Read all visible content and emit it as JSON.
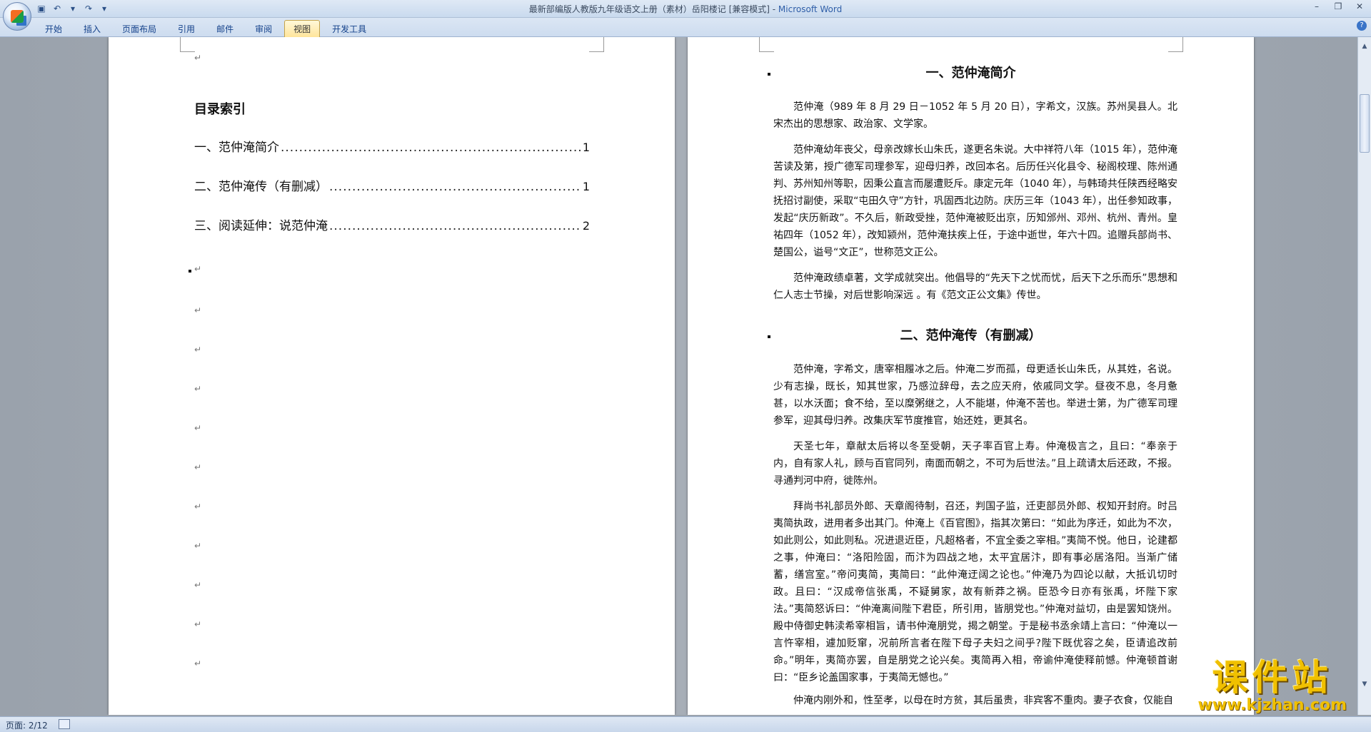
{
  "window": {
    "title": "最新部编版人教版九年级语文上册（素材）岳阳楼记 [兼容模式] - ",
    "app": "Microsoft Word"
  },
  "ribbon": {
    "tabs": [
      {
        "label": "开始"
      },
      {
        "label": "插入"
      },
      {
        "label": "页面布局"
      },
      {
        "label": "引用"
      },
      {
        "label": "邮件"
      },
      {
        "label": "审阅"
      },
      {
        "label": "视图",
        "active": true
      },
      {
        "label": "开发工具"
      }
    ]
  },
  "left_page": {
    "toc_title": "目录索引",
    "toc": [
      {
        "label": "一、范仲淹简介",
        "page": "1"
      },
      {
        "label": "二、范仲淹传（有删减）",
        "page": "1"
      },
      {
        "label": "三、阅读延伸：说范仲淹",
        "page": "2"
      }
    ]
  },
  "right_page": {
    "heading1": "一、范仲淹简介",
    "para1": "范仲淹（989 年 8 月 29 日－1052 年 5 月 20 日），字希文，汉族。苏州吴县人。北宋杰出的思想家、政治家、文学家。",
    "para2": "范仲淹幼年丧父，母亲改嫁长山朱氏，遂更名朱说。大中祥符八年（1015 年），范仲淹苦读及第，授广德军司理参军，迎母归养，改回本名。后历任兴化县令、秘阁校理、陈州通判、苏州知州等职，因秉公直言而屡遭贬斥。康定元年（1040 年），与韩琦共任陕西经略安抚招讨副使，采取“屯田久守”方针，巩固西北边防。庆历三年（1043 年），出任参知政事，发起“庆历新政”。不久后，新政受挫，范仲淹被贬出京，历知邠州、邓州、杭州、青州。皇祐四年（1052 年），改知颍州，范仲淹扶疾上任，于途中逝世，年六十四。追赠兵部尚书、楚国公，谥号“文正”，世称范文正公。",
    "para3": "范仲淹政绩卓著，文学成就突出。他倡导的“先天下之忧而忧，后天下之乐而乐”思想和仁人志士节操，对后世影响深远 。有《范文正公文集》传世。",
    "heading2": "二、范仲淹传（有删减）",
    "para4": "范仲淹，字希文，唐宰相履冰之后。仲淹二岁而孤，母更适长山朱氏，从其姓，名说。少有志操，既长，知其世家，乃感泣辞母，去之应天府，依戚同文学。昼夜不息，冬月惫甚，以水沃面；食不给，至以糜粥继之，人不能堪，仲淹不苦也。举进士第，为广德军司理参军，迎其母归养。改集庆军节度推官，始还姓，更其名。",
    "para5": "天圣七年，章献太后将以冬至受朝，天子率百官上寿。仲淹极言之，且曰：“奉亲于内，自有家人礼，顾与百官同列，南面而朝之，不可为后世法。”且上疏请太后还政，不报。寻通判河中府，徙陈州。",
    "para6": "拜尚书礼部员外郎、天章阁待制，召还，判国子监，迁吏部员外郎、权知开封府。时吕夷简执政，进用者多出其门。仲淹上《百官图》，指其次第曰：“如此为序迁，如此为不次，如此则公，如此则私。况进退近臣，凡超格者，不宜全委之宰相。”夷简不悦。他日，论建都之事，仲淹曰：“洛阳险固，而汴为四战之地，太平宜居汴，即有事必居洛阳。当渐广储蓄，缮宫室。”帝问夷简，夷简曰：“此仲淹迂阔之论也。”仲淹乃为四论以献，大抵讥切时政。且曰：“汉成帝信张禹，不疑舅家，故有新莽之祸。臣恐今日亦有张禹，坏陛下家法。”夷简怒诉曰：“仲淹离间陛下君臣，所引用，皆朋党也。”仲淹对益切，由是罢知饶州。殿中侍御史韩渎希宰相旨，请书仲淹朋党，揭之朝堂。于是秘书丞余靖上言曰：“仲淹以一言忤宰相，遽加贬窜，况前所言者在陛下母子夫妇之间乎?陛下既优容之矣，臣请追改前命。”明年，夷简亦罢，自是朋党之论兴矣。夷简再入相，帝谕仲淹使释前憾。仲淹顿首谢曰：“臣乡论盖国家事，于夷简无憾也。”",
    "para7": "仲淹内刚外和，性至孝，以母在时方贫，其后虽贵，非宾客不重肉。妻子衣食，仅能自"
  },
  "status": {
    "page": "页面: 2/12"
  },
  "watermark": {
    "cn": "课件站",
    "url": "www.kjzhan.com"
  }
}
